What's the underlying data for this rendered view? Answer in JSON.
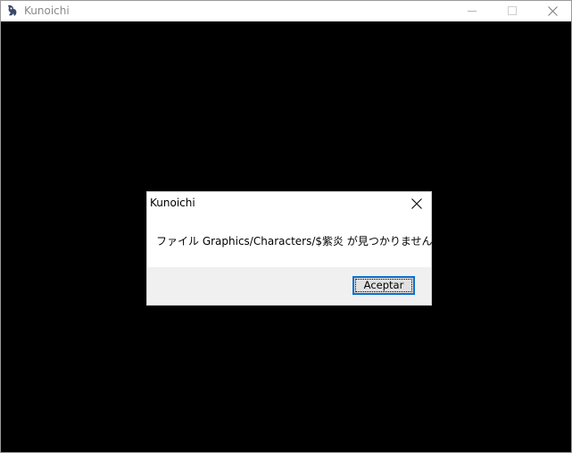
{
  "window": {
    "title": "Kunoichi",
    "app_icon": "kunoichi-app-icon",
    "controls": {
      "minimize_icon": "minimize-icon",
      "maximize_icon": "maximize-icon",
      "close_icon": "close-icon"
    }
  },
  "dialog": {
    "title": "Kunoichi",
    "message": "ファイル Graphics/Characters/$紫炎 が見つかりません。",
    "close_icon": "close-icon",
    "ok_label": "Aceptar"
  },
  "colors": {
    "client_background": "#000000",
    "titlebar_background": "#ffffff",
    "dialog_footer": "#f0f0f0",
    "button_focus_border": "#0a6fd0"
  }
}
